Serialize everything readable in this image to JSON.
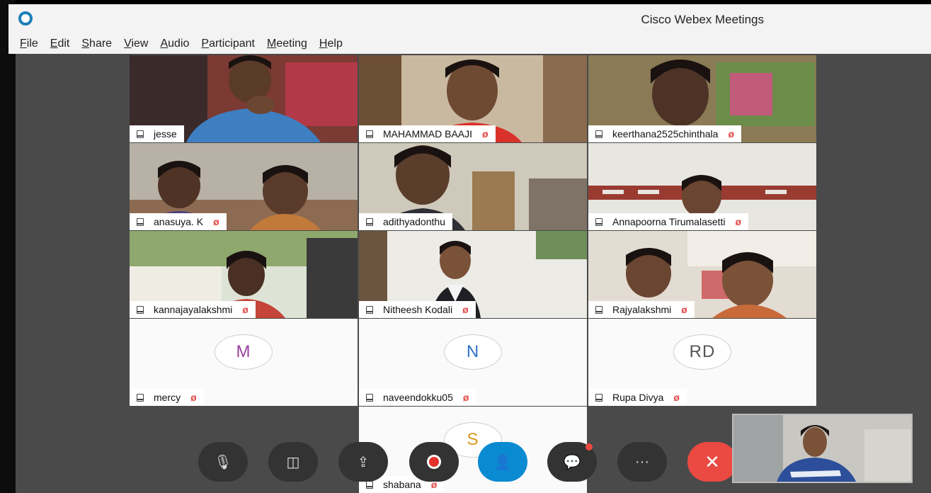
{
  "window": {
    "title": "Cisco Webex Meetings"
  },
  "menu": [
    {
      "pre": "",
      "u": "F",
      "post": "ile"
    },
    {
      "pre": "",
      "u": "E",
      "post": "dit"
    },
    {
      "pre": "",
      "u": "S",
      "post": "hare"
    },
    {
      "pre": "",
      "u": "V",
      "post": "iew"
    },
    {
      "pre": "",
      "u": "A",
      "post": "udio"
    },
    {
      "pre": "",
      "u": "P",
      "post": "articipant"
    },
    {
      "pre": "",
      "u": "M",
      "post": "eeting"
    },
    {
      "pre": "",
      "u": "H",
      "post": "elp"
    }
  ],
  "participants": [
    {
      "name": "jesse",
      "muted": false,
      "video": true
    },
    {
      "name": "MAHAMMAD BAAJI",
      "muted": true,
      "video": true
    },
    {
      "name": "keerthana2525chinthala",
      "muted": true,
      "video": true
    },
    {
      "name": "anasuya. K",
      "muted": true,
      "video": true
    },
    {
      "name": "adithyadonthu",
      "muted": false,
      "video": true
    },
    {
      "name": "Annapoorna Tirumalasetti",
      "muted": true,
      "video": true
    },
    {
      "name": "kannajayalakshmi",
      "muted": true,
      "video": true
    },
    {
      "name": "Nitheesh Kodali",
      "muted": true,
      "video": true
    },
    {
      "name": "Rajyalakshmi",
      "muted": true,
      "video": true
    },
    {
      "name": "mercy",
      "muted": true,
      "video": false,
      "initials": "M",
      "initials_color": "#9b3f9e"
    },
    {
      "name": "naveendokku05",
      "muted": true,
      "video": false,
      "initials": "N",
      "initials_color": "#2f73c8"
    },
    {
      "name": "Rupa Divya",
      "muted": true,
      "video": false,
      "initials": "RD",
      "initials_color": "#555555"
    },
    {
      "name": "shabana",
      "muted": true,
      "video": false,
      "initials": "S",
      "initials_color": "#d99a1b"
    }
  ],
  "controls": [
    {
      "name": "mute-button",
      "icon": "microphone-muted-icon",
      "glyph": "🎙"
    },
    {
      "name": "video-button",
      "icon": "video-off-icon",
      "glyph": "◫"
    },
    {
      "name": "share-button",
      "icon": "share-icon",
      "glyph": "⇪"
    },
    {
      "name": "record-button",
      "icon": "record-icon",
      "glyph": ""
    },
    {
      "name": "participants-button",
      "icon": "participants-icon",
      "glyph": "👤"
    },
    {
      "name": "chat-button",
      "icon": "chat-icon",
      "glyph": "💬"
    },
    {
      "name": "more-button",
      "icon": "more-icon",
      "glyph": "···"
    },
    {
      "name": "leave-button",
      "icon": "close-icon",
      "glyph": "✕"
    }
  ],
  "colors": {
    "accent": "#0a8ad1",
    "leave": "#ea4a42",
    "muted_icon": "#e14a47",
    "stage": "#4a4a4a"
  }
}
